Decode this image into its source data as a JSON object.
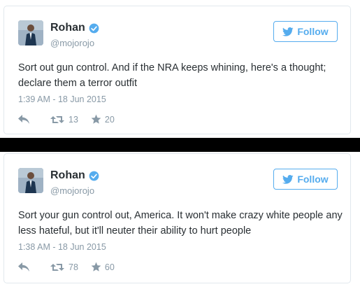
{
  "tweets": [
    {
      "name": "Rohan",
      "handle": "@mojorojo",
      "follow_label": "Follow",
      "text": "Sort out gun control. And if the NRA keeps whining, here's a thought; declare them a terror outfit",
      "timestamp": "1:39 AM - 18 Jun 2015",
      "retweets": "13",
      "favorites": "20"
    },
    {
      "name": "Rohan",
      "handle": "@mojorojo",
      "follow_label": "Follow",
      "text": "Sort your gun control out, America. It won't make crazy white people any less hateful, but it'll neuter their ability to hurt people",
      "timestamp": "1:38 AM - 18 Jun 2015",
      "retweets": "78",
      "favorites": "60"
    }
  ],
  "colors": {
    "accent": "#55acee",
    "text": "#292f33",
    "muted": "#8899a6",
    "border": "#e1e8ed",
    "divider": "#000000"
  },
  "icons": [
    "twitter-bird-icon",
    "verified-badge-icon",
    "reply-icon",
    "retweet-icon",
    "favorite-star-icon"
  ]
}
